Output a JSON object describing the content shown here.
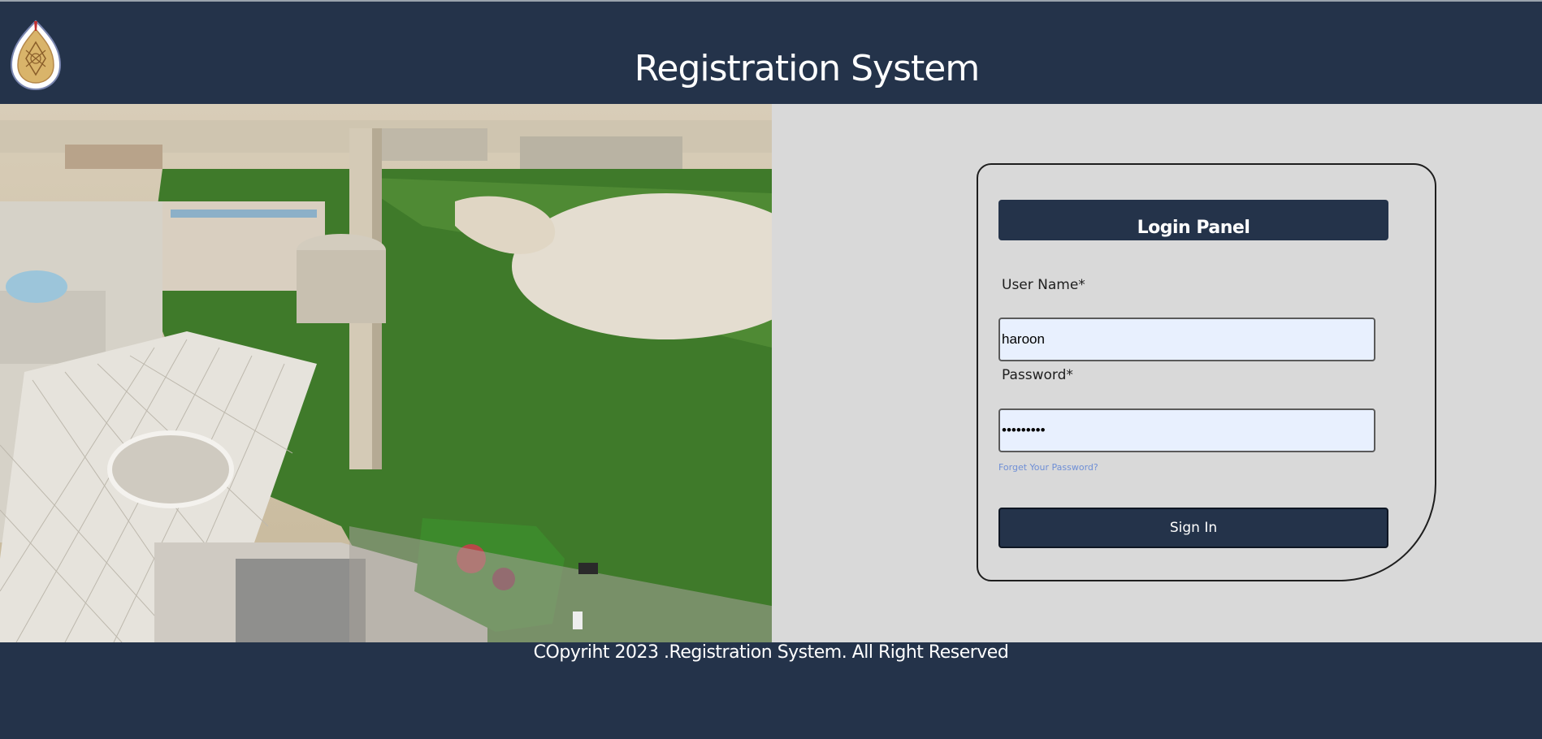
{
  "header": {
    "title": "Registration System",
    "logo_icon": "university-seal-icon"
  },
  "photo": {
    "description_icon": "campus-aerial-photo"
  },
  "login": {
    "panel_title": "Login Panel",
    "username_label": "User Name*",
    "username_value": "haroon",
    "password_label": "Password*",
    "password_value": "•••••••••",
    "forgot_link": "Forget Your Password?",
    "signin_label": "Sign In"
  },
  "footer": {
    "copyright": "COpyriht 2023 .Registration System. All Right Reserved"
  },
  "colors": {
    "navy": "#24334a",
    "panel_bg": "#d9d9d9",
    "field_bg": "#e8f0fe",
    "link": "#6f8fd6"
  }
}
